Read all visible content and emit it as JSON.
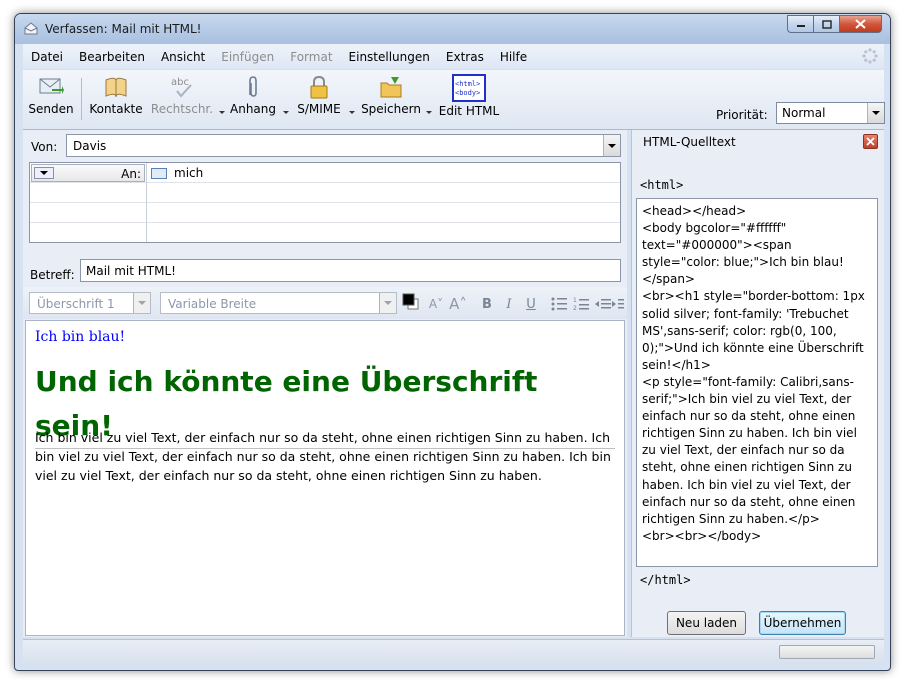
{
  "window": {
    "title": "Verfassen: Mail mit HTML!"
  },
  "menu": [
    "Datei",
    "Bearbeiten",
    "Ansicht",
    "Einfügen",
    "Format",
    "Einstellungen",
    "Extras",
    "Hilfe"
  ],
  "toolbar": {
    "send": "Senden",
    "contacts": "Kontakte",
    "spell": "Rechtschr.",
    "attach": "Anhang",
    "smime": "S/MIME",
    "save": "Speichern",
    "edit_html": "Edit HTML",
    "edit_html_icon_text": "<html>\n<body>",
    "priority_label": "Priorität:",
    "priority_value": "Normal"
  },
  "header": {
    "from_label": "Von:",
    "from_value": "Davis",
    "to_label": "An:",
    "to_value": "mich",
    "subject_label": "Betreff:",
    "subject_value": "Mail mit HTML!"
  },
  "format_bar": {
    "paragraph_style": "Überschrift 1",
    "font": "Variable Breite"
  },
  "body": {
    "blue_line": "Ich bin blau!",
    "heading": "Und ich könnte eine Überschrift sein!",
    "paragraph": "Ich bin viel zu viel Text, der einfach nur so da steht, ohne einen richtigen Sinn zu haben. Ich bin viel zu viel Text, der einfach nur so da steht, ohne einen richtigen Sinn zu haben. Ich bin viel zu viel Text, der einfach nur so da steht, ohne einen richtigen Sinn zu haben."
  },
  "source_panel": {
    "title": "HTML-Quelltext",
    "html_open": "<html>",
    "source": "<head></head>\n<body bgcolor=\"#ffffff\" text=\"#000000\"><span style=\"color: blue;\">Ich bin blau!</span>\n<br><h1 style=\"border-bottom: 1px solid silver; font-family: 'Trebuchet MS',sans-serif; color: rgb(0, 100, 0);\">Und ich könnte eine Überschrift sein!</h1>\n<p style=\"font-family: Calibri,sans-serif;\">Ich bin viel zu viel Text, der einfach nur so da steht, ohne einen richtigen Sinn zu haben. Ich bin viel zu viel Text, der einfach nur so da steht, ohne einen richtigen Sinn zu haben. Ich bin viel zu viel Text, der einfach nur so da steht, ohne einen richtigen Sinn zu haben.</p>\n<br><br></body>",
    "html_close": "</html>",
    "reload_button": "Neu laden",
    "apply_button": "Übernehmen"
  },
  "colors": {
    "heading_green": "#006400",
    "blue_text": "#0000ff"
  }
}
